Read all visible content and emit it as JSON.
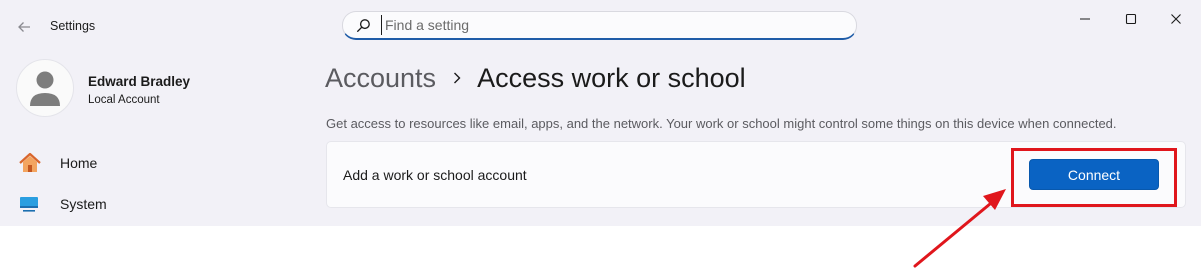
{
  "window": {
    "app_title": "Settings",
    "back_icon": "arrow-left-icon",
    "controls": {
      "minimize_icon": "minimize-icon",
      "maximize_icon": "maximize-icon",
      "close_icon": "close-icon"
    }
  },
  "search": {
    "placeholder": "Find a setting",
    "value": "",
    "icon": "search-icon"
  },
  "profile": {
    "name": "Edward Bradley",
    "account_type": "Local Account",
    "avatar_icon": "person-avatar-icon"
  },
  "sidebar": {
    "items": [
      {
        "label": "Home",
        "icon": "home-icon"
      },
      {
        "label": "System",
        "icon": "monitor-icon"
      }
    ]
  },
  "breadcrumb": {
    "parent": "Accounts",
    "separator_icon": "chevron-right-icon",
    "current": "Access work or school"
  },
  "main": {
    "description": "Get access to resources like email, apps, and the network. Your work or school might control some things on this device when connected.",
    "card": {
      "label": "Add a work or school account",
      "button_label": "Connect"
    }
  },
  "annotation": {
    "highlight_color": "#e0161c",
    "arrow_color": "#e0161c"
  },
  "colors": {
    "accent": "#0a63c3",
    "window_background": "#f2f1f7",
    "card_background": "#fbfbfd"
  }
}
